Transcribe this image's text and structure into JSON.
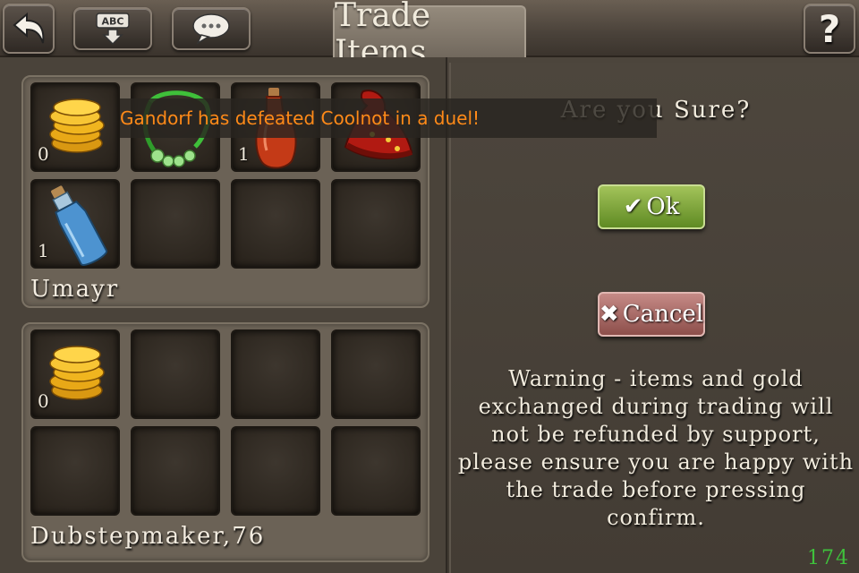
{
  "header": {
    "title": "Trade Items",
    "back_icon": "back-arrow-icon",
    "keyboard_button": {
      "text": "ABC",
      "icon": "keyboard-icon"
    },
    "chat_icon": "chat-bubble-icon",
    "help_label": "?"
  },
  "notification": "Gandorf has defeated Coolnot in a duel!",
  "my_offer": {
    "player_name": "Umayr",
    "slots": [
      {
        "item": "gold-coins",
        "count": "0"
      },
      {
        "item": "green-amulet",
        "count": ""
      },
      {
        "item": "red-potion",
        "count": "1"
      },
      {
        "item": "red-wizard-hat",
        "count": ""
      },
      {
        "item": "blue-potion",
        "count": "1"
      },
      {
        "item": "empty",
        "count": ""
      },
      {
        "item": "empty",
        "count": ""
      },
      {
        "item": "empty",
        "count": ""
      }
    ]
  },
  "their_offer": {
    "player_name": "Dubstepmaker,76",
    "slots": [
      {
        "item": "gold-coins",
        "count": "0"
      },
      {
        "item": "empty",
        "count": ""
      },
      {
        "item": "empty",
        "count": ""
      },
      {
        "item": "empty",
        "count": ""
      },
      {
        "item": "empty",
        "count": ""
      },
      {
        "item": "empty",
        "count": ""
      },
      {
        "item": "empty",
        "count": ""
      },
      {
        "item": "empty",
        "count": ""
      }
    ]
  },
  "confirm": {
    "question": "Are you Sure?",
    "ok_label": "Ok",
    "cancel_label": "Cancel",
    "warning": "Warning - items and gold exchanged during trading will not be refunded by support, please ensure you are happy with the trade before pressing confirm.",
    "counter": "174"
  },
  "colors": {
    "notification_text": "#ff8a18",
    "counter_text": "#3fc13c",
    "ok_button": "#7aa23a",
    "cancel_button": "#a86a66"
  }
}
